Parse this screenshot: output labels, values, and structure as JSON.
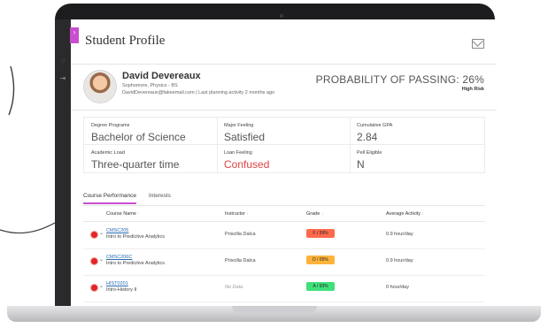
{
  "window": {
    "title": "Student Profile"
  },
  "student": {
    "name": "David Devereaux",
    "program_line": "Sophomore, Physics - BS",
    "contact_line": "DavidDevereaux@fakeemail.com | Last planning activity 2 months ago"
  },
  "probability": {
    "label": "PROBABILITY OF PASSING: 26%",
    "risk": "High Risk"
  },
  "info": {
    "degree_programs": {
      "label": "Degree Programs",
      "value": "Bachelor of Science"
    },
    "major_feeling": {
      "label": "Major Feeling",
      "value": "Satisfied"
    },
    "cumulative_gpa": {
      "label": "Cumulative GPA",
      "value": "2.84"
    },
    "academic_load": {
      "label": "Academic Load",
      "value": "Three-quarter time"
    },
    "loan_feeling": {
      "label": "Loan Feeling",
      "value": "Confused"
    },
    "pell_eligible": {
      "label": "Pell Eligible",
      "value": "N"
    }
  },
  "tabs": [
    {
      "label": "Course Performance"
    },
    {
      "label": "Interests"
    }
  ],
  "table": {
    "headers": [
      "Course Name",
      "Instructor",
      "Grade",
      "Average Activity"
    ],
    "rows": [
      {
        "code": "CMSC205",
        "name": "Intro to Predictive Analytics",
        "instructor": "Priscilla Dalca",
        "grade": "F / 59%",
        "grade_color": "#ff6a4d",
        "activity": "0.9 hour/day"
      },
      {
        "code": "CMSC206C",
        "name": "Intro to Predictive Analytics",
        "instructor": "Priscilla Dalca",
        "grade": "D / 65%",
        "grade_color": "#ffb33b",
        "activity": "0.9 hour/day"
      },
      {
        "code": "HIST0201",
        "name": "Intro-History II",
        "instructor": "No Data",
        "grade": "A / 93%",
        "grade_color": "#3fe07a",
        "activity": "0 hour/day"
      }
    ]
  },
  "colors": {
    "accent": "#c84fcf",
    "risk": "#e02727",
    "link": "#2a69b3"
  },
  "icons": {
    "mail": "mail-icon",
    "bookmark": "bookmark-icon",
    "expand": "chevron-down-icon"
  }
}
